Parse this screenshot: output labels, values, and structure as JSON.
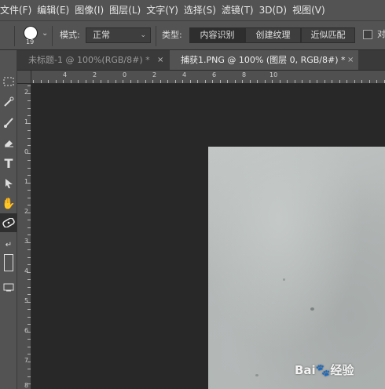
{
  "menu": [
    "文件(F)",
    "编辑(E)",
    "图像(I)",
    "图层(L)",
    "文字(Y)",
    "选择(S)",
    "滤镜(T)",
    "3D(D)",
    "视图(V)"
  ],
  "options": {
    "brush_size": "19",
    "mode_label": "模式:",
    "mode_value": "正常",
    "type_label": "类型:",
    "type_buttons": [
      "内容识别",
      "创建纹理",
      "近似匹配"
    ],
    "trailing_text": "对"
  },
  "tabs": [
    {
      "label": "未标题-1 @ 100%(RGB/8#) *",
      "close": "×"
    },
    {
      "label": "捕获1.PNG @ 100% (图层 0, RGB/8#) *",
      "close": "×"
    }
  ],
  "ruler_top_numbers": [
    "4",
    "2",
    "0",
    "2",
    "4",
    "6",
    "8",
    "10"
  ],
  "ruler_left_numbers": [
    "2",
    "1",
    "0",
    "1",
    "2",
    "3",
    "4",
    "5",
    "6",
    "7",
    "8"
  ],
  "watermark": "Bai🐾经验",
  "icons": [
    "marquee-icon",
    "quick-select-icon",
    "brush-icon",
    "eraser-icon",
    "type-icon",
    "path-select-icon",
    "hand-icon",
    "patch-tool-icon",
    "swap-colors-icon",
    "color-swatch-icon",
    "screen-mode-icon"
  ]
}
